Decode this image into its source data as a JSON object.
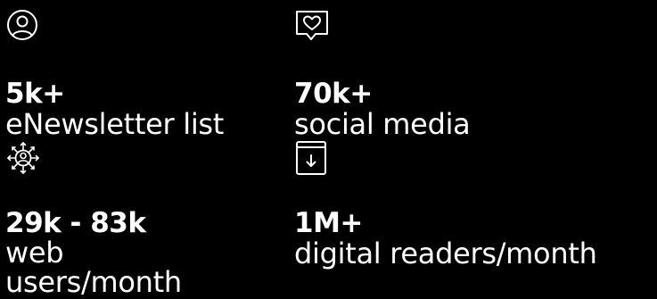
{
  "stats": [
    {
      "icon": "user-circle-icon",
      "value": "5k+",
      "label": "eNewsletter list"
    },
    {
      "icon": "heart-chat-icon",
      "value": "70k+",
      "label": "social media"
    },
    {
      "icon": "user-network-icon",
      "value": "29k - 83k",
      "label": "web users/month"
    },
    {
      "icon": "book-download-icon",
      "value": "1M+",
      "label": "digital readers/month"
    }
  ],
  "colors": {
    "background": "#000000",
    "text": "#ffffff"
  }
}
